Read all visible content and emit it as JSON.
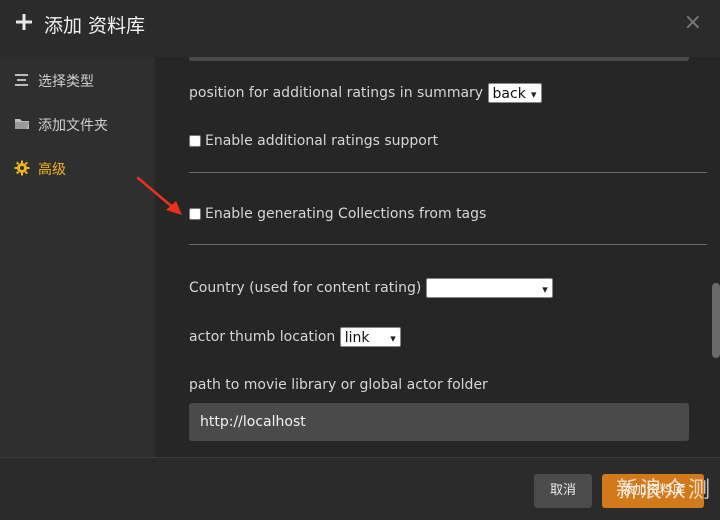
{
  "header": {
    "title": "添加 资料库",
    "close_glyph": "×"
  },
  "sidebar": {
    "items": [
      {
        "label": "选择类型",
        "icon": "list-icon",
        "active": false
      },
      {
        "label": "添加文件夹",
        "icon": "folder-icon",
        "active": false
      },
      {
        "label": "高级",
        "icon": "gear-icon",
        "active": true
      }
    ]
  },
  "main": {
    "additional_ratings_position": {
      "label": "position for additional ratings in summary",
      "value": "back"
    },
    "enable_additional_ratings": {
      "label": "Enable additional ratings support",
      "checked": false
    },
    "enable_collections_from_tags": {
      "label": "Enable generating Collections from tags",
      "checked": false
    },
    "country": {
      "label": "Country (used for content rating)",
      "value": ""
    },
    "actor_thumb_location": {
      "label": "actor thumb location",
      "value": "link"
    },
    "movie_library_path": {
      "label": "path to movie library or global actor folder",
      "value": "http://localhost"
    }
  },
  "footer": {
    "cancel_label": "取消",
    "add_label": "添加资料库"
  },
  "watermark": {
    "text": "新浪众测"
  },
  "colors": {
    "accent": "#f0b31c",
    "primary_button": "#d2791c",
    "annotation_arrow": "#e8321e"
  }
}
